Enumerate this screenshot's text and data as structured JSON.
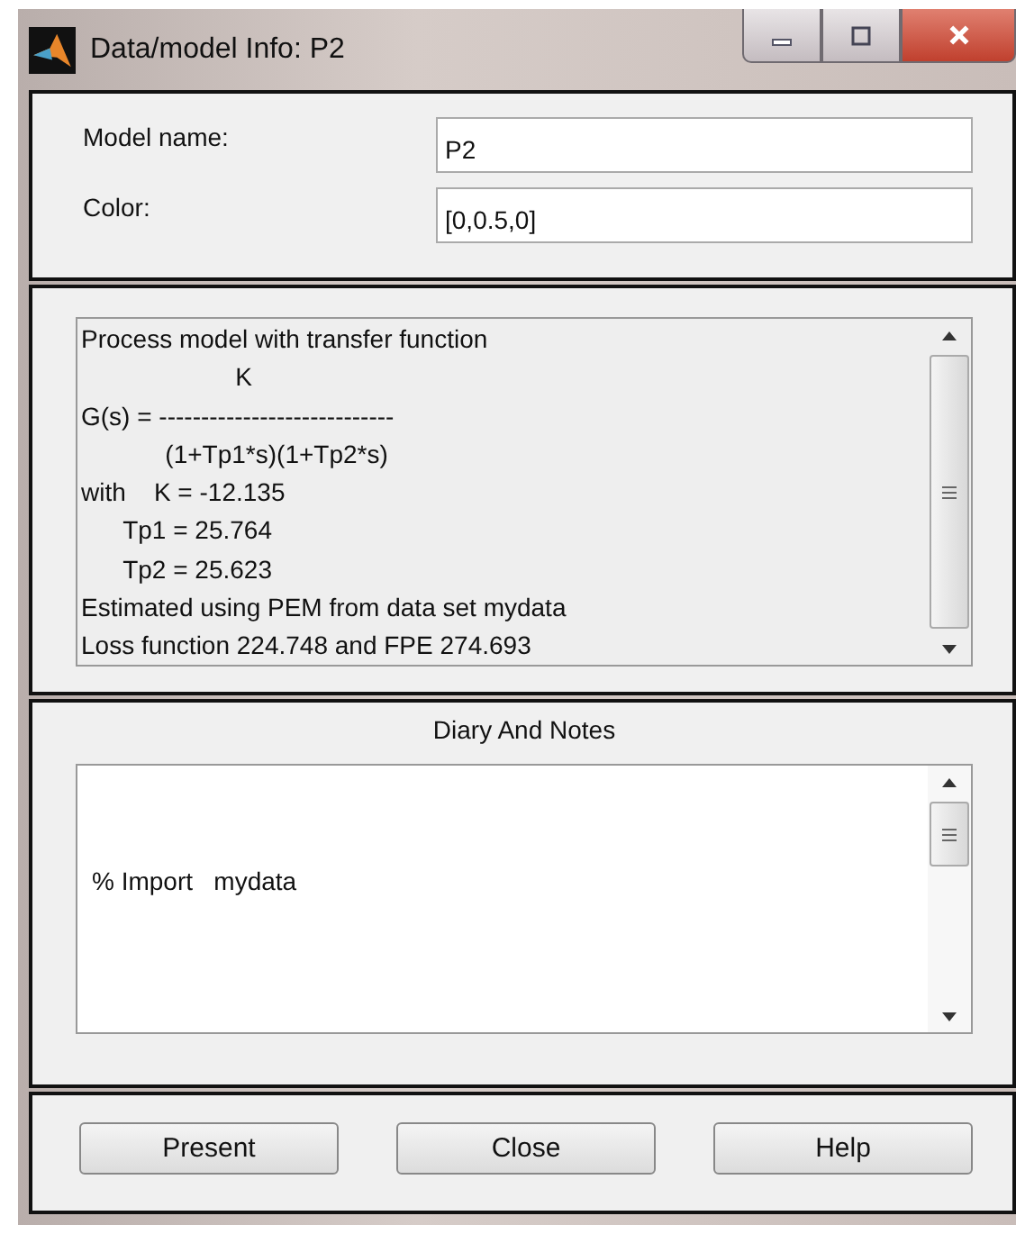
{
  "window": {
    "title": "Data/model Info: P2"
  },
  "fields": [
    {
      "label": "Model name:",
      "value": "P2"
    },
    {
      "label": "Color:",
      "value": "[0,0.5,0]"
    }
  ],
  "info_lines": [
    "Process model with transfer function",
    "                      K",
    "G(s) = ----------------------------",
    "            (1+Tp1*s)(1+Tp2*s)",
    "with    K = -12.135",
    "      Tp1 = 25.764",
    "      Tp2 = 25.623",
    "Estimated using PEM from data set mydata",
    "Loss function 224.748 and FPE 274.693"
  ],
  "diary": {
    "title": "Diary And Notes",
    "lines": [
      "% Import   mydata"
    ]
  },
  "buttons": [
    "Present",
    "Close",
    "Help"
  ]
}
